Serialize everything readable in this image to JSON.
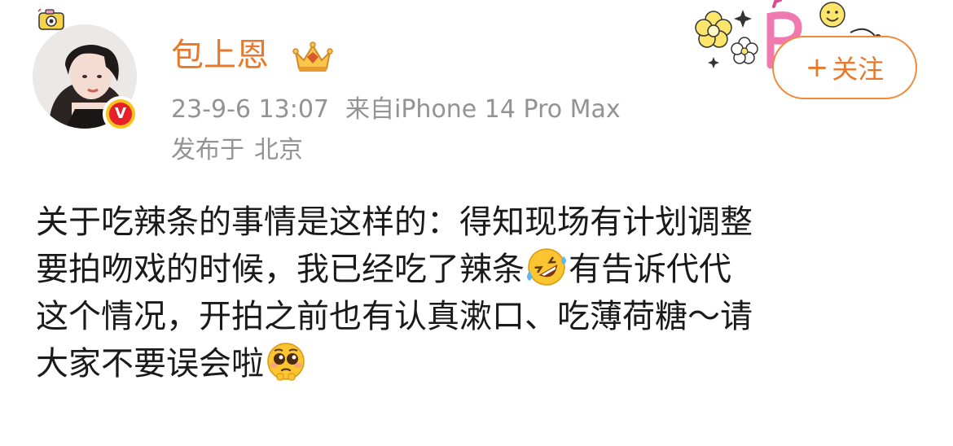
{
  "user": {
    "name": "包上恩",
    "avatar_icon": "user-avatar-photo",
    "verified_icon": "verified-v-badge",
    "verified_mark": "V",
    "vip_icon": "vip-crown-icon"
  },
  "post_meta": {
    "time": "23-9-6 13:07",
    "source": "来自iPhone 14 Pro Max",
    "location_prefix": "发布于",
    "location": "北京"
  },
  "follow_button": {
    "plus": "+",
    "label": "关注"
  },
  "post": {
    "line1": "关于吃辣条的事情是这样的：得知现场有计划调整",
    "line2_a": "要拍吻戏的时候，我已经吃了辣条",
    "line2_emoji": "rolling-laughing-emoji",
    "line2_b": "有告诉代代",
    "line3": "这个情况，开拍之前也有认真漱口、吃薄荷糖～请",
    "line4_a": "大家不要误会啦",
    "line4_emoji": "pleading-face-emoji"
  },
  "colors": {
    "accent": "#e8782b",
    "meta_text": "#939393",
    "body_text": "#1a1a1a",
    "verified_bg": "#f9c21c",
    "verified_inner": "#e8202a"
  }
}
